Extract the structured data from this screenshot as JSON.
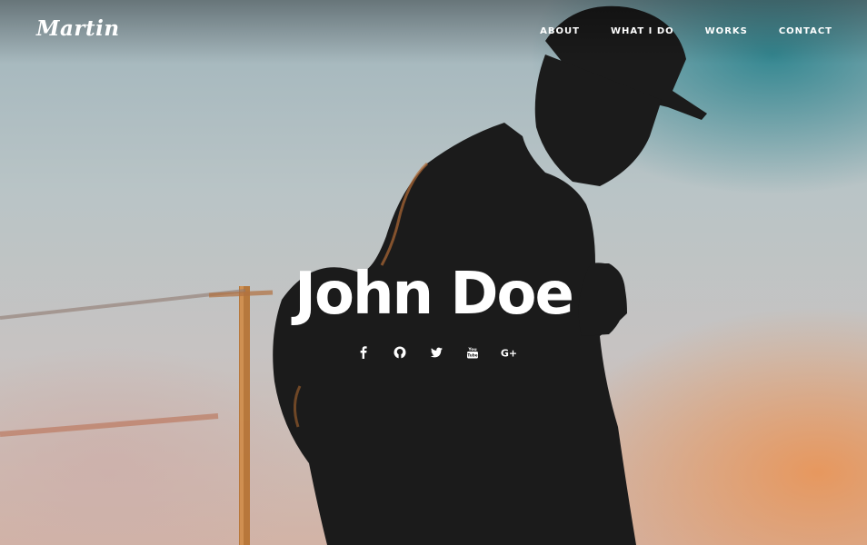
{
  "header": {
    "logo": "Martin",
    "nav": [
      {
        "label": "ABOUT"
      },
      {
        "label": "WHAT I DO"
      },
      {
        "label": "WORKS"
      },
      {
        "label": "CONTACT"
      }
    ]
  },
  "hero": {
    "name": "John Doe",
    "social_icons": [
      "facebook-icon",
      "github-icon",
      "twitter-icon",
      "youtube-icon",
      "google-plus-icon"
    ],
    "youtube_glyph_text": "You Tube",
    "google_plus_text": "G+"
  },
  "colors": {
    "text": "#ffffff",
    "silhouette": "#1b1b1b",
    "sky_teal": "#2a8a90",
    "sky_orange": "#e8965a"
  }
}
